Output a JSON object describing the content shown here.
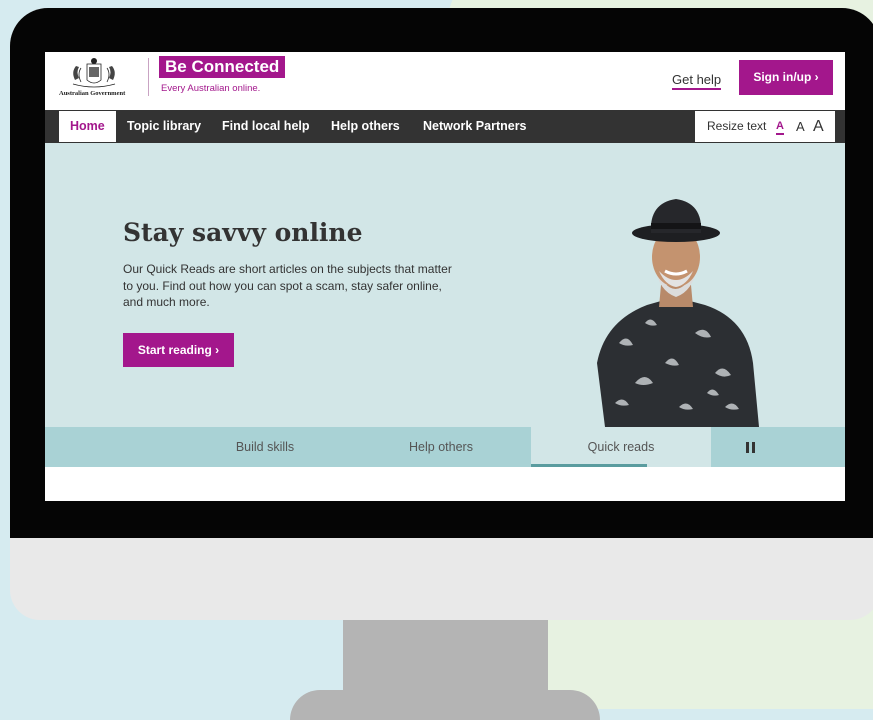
{
  "header": {
    "gov_label": "Australian Government",
    "brand_name": "Be Connected",
    "tagline": "Every Australian online.",
    "get_help": "Get help",
    "sign_in": "Sign in/up ›"
  },
  "nav": {
    "items": [
      "Home",
      "Topic library",
      "Find local help",
      "Help others",
      "Network Partners"
    ],
    "resize_label": "Resize text",
    "resize_small": "A",
    "resize_medium": "A",
    "resize_large": "A"
  },
  "hero": {
    "title": "Stay savvy online",
    "body": "Our Quick Reads are short articles on the subjects that matter to you. Find out how you can spot a scam, stay safer online, and much more.",
    "button": "Start reading ›"
  },
  "tabs": {
    "items": [
      "Build skills",
      "Help others",
      "Quick reads"
    ],
    "active": "Quick reads"
  },
  "colors": {
    "brand": "#a3178c",
    "nav_bg": "#333333",
    "hero_bg": "#d2e6e7",
    "tabs_bg": "#a9d2d5"
  }
}
